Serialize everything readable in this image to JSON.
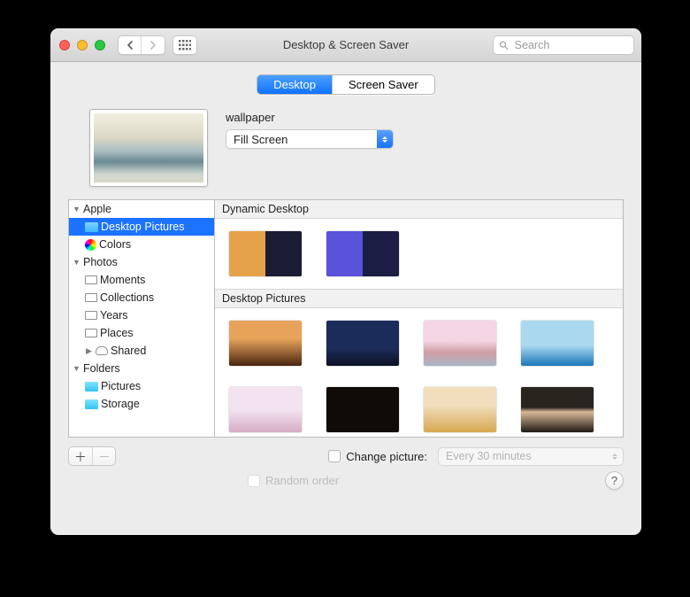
{
  "window": {
    "title": "Desktop & Screen Saver"
  },
  "search": {
    "placeholder": "Search"
  },
  "tabs": {
    "desktop": "Desktop",
    "screensaver": "Screen Saver"
  },
  "preview": {
    "name": "wallpaper",
    "fit_mode": "Fill Screen",
    "gradient": "linear-gradient(180deg,#f3efe0 0%,#dcd8c7 35%,#a9bcc1 55%,#6a8a93 70%,#cfd6d0 88%,#d8d7c9 100%)"
  },
  "sidebar": {
    "apple": {
      "label": "Apple",
      "desktop_pictures": "Desktop Pictures",
      "colors": "Colors"
    },
    "photos": {
      "label": "Photos",
      "moments": "Moments",
      "collections": "Collections",
      "years": "Years",
      "places": "Places",
      "shared": "Shared"
    },
    "folders": {
      "label": "Folders",
      "pictures": "Pictures",
      "storage": "Storage"
    }
  },
  "sections": {
    "dynamic": "Dynamic Desktop",
    "pictures": "Desktop Pictures"
  },
  "thumbs": {
    "dyn": [
      "linear-gradient(90deg,#e6a24a 0 50%,#1a1d33 50% 100%)",
      "linear-gradient(90deg,#5a52d8 0 50%,#1a1d44 50% 100%)"
    ],
    "pics": [
      "linear-gradient(180deg,#e7a35a 40%,#4a260f 100%)",
      "linear-gradient(180deg,#1c2c5a 60%,#0b1226 100%)",
      "linear-gradient(180deg,#f4d6e4 45%,#cf9ea4 70%,#a8b6c7 100%)",
      "linear-gradient(180deg,#a9d8ef 55%,#1a77b8 100%)",
      "linear-gradient(180deg,#f3e3f0 50%,#d5acc3 100%)",
      "linear-gradient(180deg,#100a08 70%,#100a08 100%)",
      "linear-gradient(180deg,#f0debd 40%,#d8a850 100%)",
      "linear-gradient(180deg,#2a241f 45%,#d9b998 55%,#1f1a15 100%)",
      "linear-gradient(180deg,#3a62b9 60%,#1a2d6c 100%)",
      "linear-gradient(180deg,#3a62b9 60%,#1a2d6c 100%)",
      "linear-gradient(180deg,#f0b080 50%,#c97850 100%)",
      "linear-gradient(180deg,#f0b080 50%,#c97850 100%)"
    ]
  },
  "controls": {
    "change_picture": "Change picture:",
    "interval": "Every 30 minutes",
    "random": "Random order"
  }
}
